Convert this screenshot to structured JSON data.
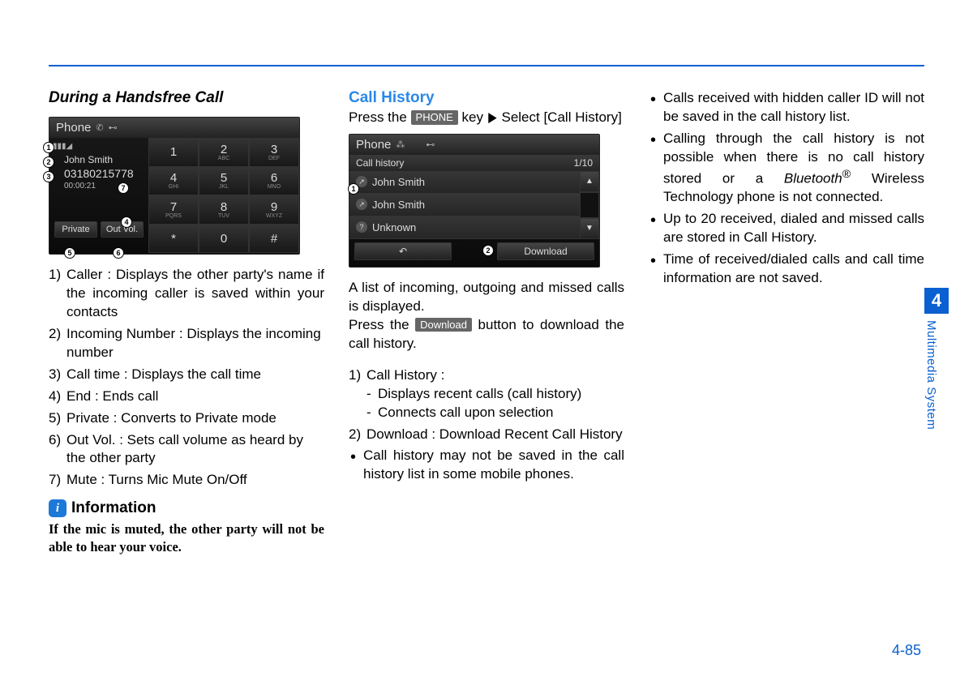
{
  "header": {
    "rule": true
  },
  "col1": {
    "heading": "During a Handsfree Call",
    "screen": {
      "title": "Phone",
      "caller_name": "John Smith",
      "caller_number": "03180215778",
      "call_time": "00:00:21",
      "buttons": {
        "private": "Private",
        "out_vol": "Out Vol."
      },
      "keypad": [
        {
          "d": "1",
          "s": ""
        },
        {
          "d": "2",
          "s": "ABC"
        },
        {
          "d": "3",
          "s": "DEF"
        },
        {
          "d": "4",
          "s": "GHI"
        },
        {
          "d": "5",
          "s": "JKL"
        },
        {
          "d": "6",
          "s": "MNO"
        },
        {
          "d": "7",
          "s": "PQRS"
        },
        {
          "d": "8",
          "s": "TUV"
        },
        {
          "d": "9",
          "s": "WXYZ"
        },
        {
          "d": "*",
          "s": ""
        },
        {
          "d": "0",
          "s": ""
        },
        {
          "d": "#",
          "s": ""
        }
      ],
      "callouts": [
        "1",
        "2",
        "3",
        "4",
        "5",
        "6",
        "7"
      ]
    },
    "list": [
      "Caller : Displays the other party's name if the incoming caller is saved within your contacts",
      "Incoming Number : Displays the incoming number",
      "Call time : Displays the call time",
      "End : Ends call",
      "Private : Converts to Private mode",
      "Out Vol. : Sets call volume as heard by the other party",
      "Mute : Turns Mic Mute On/Off"
    ],
    "info": {
      "label": "Information",
      "icon": "i",
      "text": "If the mic is muted, the other party will not be able to hear your voice."
    }
  },
  "col2": {
    "heading": "Call History",
    "instr_pre": "Press the ",
    "instr_key": "PHONE",
    "instr_mid": " key ",
    "instr_arrow": "▶",
    "instr_post": " Select [Call History]",
    "screen": {
      "title": "Phone",
      "sub": "Call history",
      "page": "1/10",
      "rows": [
        "John Smith",
        "John Smith",
        "Unknown"
      ],
      "download": "Download",
      "back": "↶",
      "callouts": [
        "1",
        "2"
      ]
    },
    "para1": "A list of incoming, outgoing and missed calls is displayed.",
    "para2_pre": "Press the ",
    "para2_btn": "Download",
    "para2_post": " button to down­load the call history.",
    "list": [
      {
        "t": "Call History :",
        "subs": [
          "Displays recent calls (call history)",
          "Connects call upon selection"
        ]
      },
      {
        "t": "Download : Download Recent Call History"
      }
    ],
    "bullet": "Call history may not be saved in the call history list in some mobile phones."
  },
  "col3": {
    "bullets": [
      "Calls received with hidden caller ID will not be saved in the call history list.",
      {
        "pre": "Calling through the call history is not possible when there is no call history stored or a ",
        "em": "Bluetooth",
        "sup": "®",
        "post": " Wireless Technology phone is not connected."
      },
      "Up to 20 received, dialed and missed calls are stored in Call History.",
      "Time of received/dialed calls and call time information are not saved."
    ]
  },
  "tab": {
    "chapter": "4",
    "label": "Multimedia System"
  },
  "page": "4-85"
}
